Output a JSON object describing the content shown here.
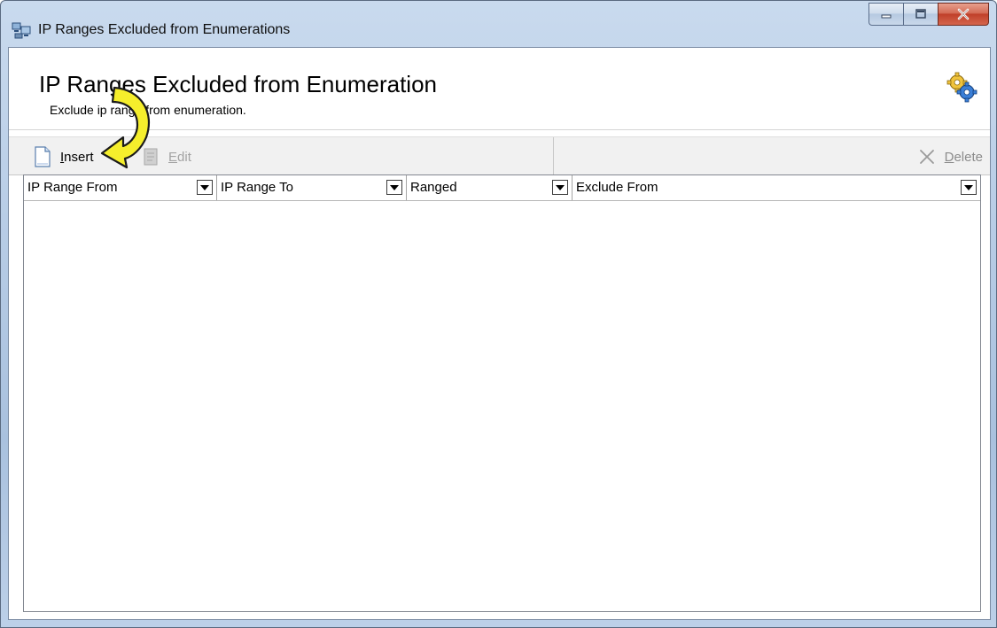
{
  "window": {
    "title": "IP Ranges Excluded from Enumerations"
  },
  "header": {
    "title": "IP Ranges Excluded from Enumeration",
    "subtitle": "Exclude ip range from enumeration."
  },
  "toolbar": {
    "insert_label": "Insert",
    "edit_label": "Edit",
    "delete_label": "Delete"
  },
  "grid": {
    "columns": [
      {
        "label": "IP Range From"
      },
      {
        "label": "IP Range To"
      },
      {
        "label": "Ranged"
      },
      {
        "label": "Exclude From"
      }
    ],
    "rows": []
  },
  "icons": {
    "app": "network-computers-icon",
    "header": "gears-icon",
    "insert": "new-document-icon",
    "edit": "edit-icon",
    "delete": "x-delete-icon",
    "annotation": "curved-arrow-icon"
  },
  "colors": {
    "annotation_arrow": "#f5ee2c",
    "close_button": "#c9452f",
    "disabled_text": "#a3a3a3"
  }
}
